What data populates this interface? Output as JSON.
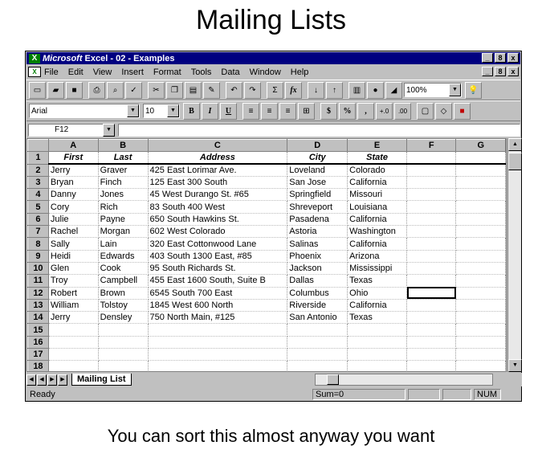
{
  "slide": {
    "title": "Mailing Lists",
    "caption": "You can sort this almost anyway you want"
  },
  "window": {
    "app_name": "Microsoft",
    "title_rest": " Excel - 02 - Examples",
    "buttons": [
      "_",
      "8",
      "x"
    ]
  },
  "menu": {
    "items": [
      "File",
      "Edit",
      "View",
      "Insert",
      "Format",
      "Tools",
      "Data",
      "Window",
      "Help"
    ]
  },
  "toolbar": {
    "zoom": "100%",
    "font_name": "Arial",
    "font_size": "10",
    "bold": "B",
    "italic": "I",
    "underline": "U",
    "currency": "$",
    "percent": "%",
    "comma": ",",
    "inc_decimal": "+.0",
    "dec_decimal": ".00",
    "sum": "Σ",
    "fx": "fx"
  },
  "name_box": "F12",
  "grid": {
    "columns": [
      "A",
      "B",
      "C",
      "D",
      "E",
      "F",
      "G"
    ],
    "rows": [
      {
        "n": "1",
        "cells": [
          "First",
          "Last",
          "Address",
          "City",
          "State"
        ]
      },
      {
        "n": "2",
        "cells": [
          "Jerry",
          "Graver",
          "425 East Lorimar Ave.",
          "Loveland",
          "Colorado"
        ]
      },
      {
        "n": "3",
        "cells": [
          "Bryan",
          "Finch",
          "125 East 300 South",
          "San Jose",
          "California"
        ]
      },
      {
        "n": "4",
        "cells": [
          "Danny",
          "Jones",
          "45 West Durango St. #65",
          "Springfield",
          "Missouri"
        ]
      },
      {
        "n": "5",
        "cells": [
          "Cory",
          "Rich",
          "83 South 400 West",
          "Shreveport",
          "Louisiana"
        ]
      },
      {
        "n": "6",
        "cells": [
          "Julie",
          "Payne",
          "650 South Hawkins St.",
          "Pasadena",
          "California"
        ]
      },
      {
        "n": "7",
        "cells": [
          "Rachel",
          "Morgan",
          "602 West Colorado",
          "Astoria",
          "Washington"
        ]
      },
      {
        "n": "8",
        "cells": [
          "Sally",
          "Lain",
          "320 East Cottonwood Lane",
          "Salinas",
          "California"
        ]
      },
      {
        "n": "9",
        "cells": [
          "Heidi",
          "Edwards",
          "403 South 1300 East, #85",
          "Phoenix",
          "Arizona"
        ]
      },
      {
        "n": "10",
        "cells": [
          "Glen",
          "Cook",
          "95 South Richards St.",
          "Jackson",
          "Mississippi"
        ]
      },
      {
        "n": "11",
        "cells": [
          "Troy",
          "Campbell",
          "455 East 1600 South, Suite B",
          "Dallas",
          "Texas"
        ]
      },
      {
        "n": "12",
        "cells": [
          "Robert",
          "Brown",
          "6545 South 700 East",
          "Columbus",
          "Ohio"
        ]
      },
      {
        "n": "13",
        "cells": [
          "William",
          "Tolstoy",
          "1845 West 600 North",
          "Riverside",
          "California"
        ]
      },
      {
        "n": "14",
        "cells": [
          "Jerry",
          "Densley",
          "750 North Main, #125",
          "San Antonio",
          "Texas"
        ]
      },
      {
        "n": "15",
        "cells": [
          "",
          "",
          "",
          "",
          ""
        ]
      },
      {
        "n": "16",
        "cells": [
          "",
          "",
          "",
          "",
          ""
        ]
      },
      {
        "n": "17",
        "cells": [
          "",
          "",
          "",
          "",
          ""
        ]
      },
      {
        "n": "18",
        "cells": [
          "",
          "",
          "",
          "",
          ""
        ]
      }
    ]
  },
  "sheet_tab": "Mailing List",
  "status": {
    "ready": "Ready",
    "sum": "Sum=0",
    "num": "NUM"
  }
}
